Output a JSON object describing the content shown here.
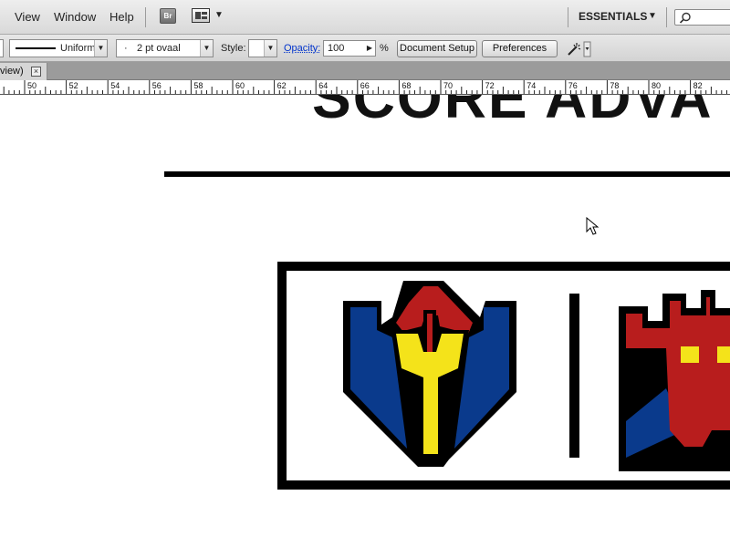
{
  "menubar": {
    "items": [
      "View",
      "Window",
      "Help"
    ],
    "bridge_label": "Br",
    "workspace": "ESSENTIALS"
  },
  "controlbar": {
    "stroke_profile": "Uniform",
    "brush_dot": "·",
    "brush": "2 pt ovaal",
    "style_label": "Style:",
    "opacity_label": "Opacity:",
    "opacity_value": "100",
    "opacity_unit": "%",
    "document_setup": "Document Setup",
    "preferences": "Preferences"
  },
  "tab": {
    "label": "view)",
    "close": "×"
  },
  "ruler": {
    "labels": [
      "50",
      "52",
      "54",
      "56",
      "58",
      "60",
      "62",
      "64",
      "66",
      "68",
      "70",
      "72",
      "74",
      "76",
      "78",
      "80",
      "82"
    ]
  },
  "canvas": {
    "title": "SCORE ADVA"
  },
  "colors": {
    "blue": "#0a3a8c",
    "red": "#b81d1d",
    "yellow": "#f4e31a"
  }
}
